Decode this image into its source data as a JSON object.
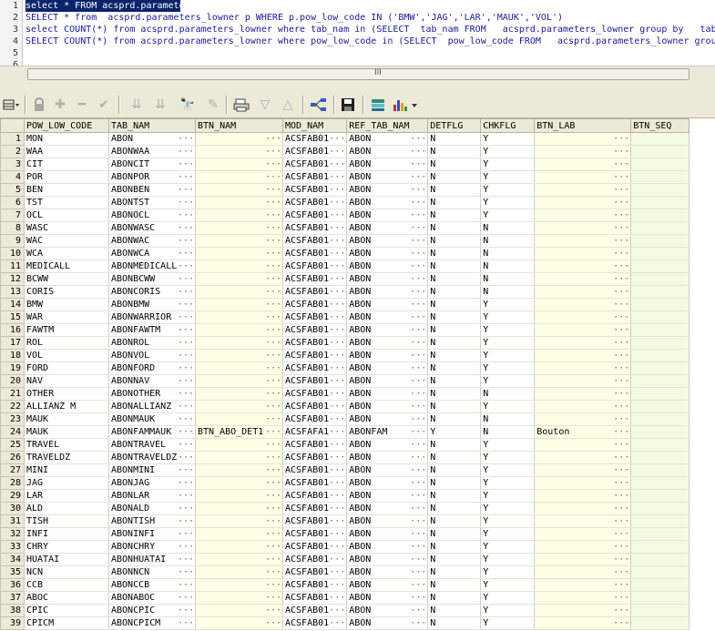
{
  "editor": {
    "line_numbers": [
      "1",
      "2",
      "3",
      "4",
      "5",
      "6"
    ],
    "lines": [
      "select * FROM acsprd.parameters_lowner",
      "SELECT * from  acsprd.parameters_lowner p WHERE p.pow_low_code IN ('BMW','JAG','LAR','MAUK','VOL')",
      "select COUNT(*) from acsprd.parameters_lowner where tab_nam in (SELECT  tab_nam FROM   acsprd.parameters_lowner group by   tab",
      "SELECT COUNT(*) from acsprd.parameters_lowner where pow_low_code in (SELECT  pow_low_code FROM   acsprd.parameters_lowner grou",
      "",
      ""
    ]
  },
  "scrollbar": {
    "grip": "III"
  },
  "toolbar": {
    "icons": [
      "lock-icon",
      "plus-icon",
      "minus-icon",
      "check-icon",
      "down-arrows-icon",
      "down-arrows-icon",
      "binoculars-icon",
      "eraser-icon",
      "print-icon",
      "triangle-down-icon",
      "triangle-up-icon",
      "graph-icon",
      "save-icon",
      "query-icon",
      "chart-icon"
    ]
  },
  "grid": {
    "columns": [
      "POW_LOW_CODE",
      "TAB_NAM",
      "BTN_NAM",
      "MOD_NAM",
      "REF_TAB_NAM",
      "DETFLG",
      "CHKFLG",
      "BTN_LAB",
      "BTN_SEQ"
    ],
    "rows": [
      [
        "1",
        "MON",
        "ABON",
        "",
        "ACSFAB01",
        "ABON",
        "N",
        "Y",
        "",
        ""
      ],
      [
        "2",
        "WAA",
        "ABONWAA",
        "",
        "ACSFAB01",
        "ABON",
        "N",
        "Y",
        "",
        ""
      ],
      [
        "3",
        "CIT",
        "ABONCIT",
        "",
        "ACSFAB01",
        "ABON",
        "N",
        "Y",
        "",
        ""
      ],
      [
        "4",
        "POR",
        "ABONPOR",
        "",
        "ACSFAB01",
        "ABON",
        "N",
        "Y",
        "",
        ""
      ],
      [
        "5",
        "BEN",
        "ABONBEN",
        "",
        "ACSFAB01",
        "ABON",
        "N",
        "Y",
        "",
        ""
      ],
      [
        "6",
        "TST",
        "ABONTST",
        "",
        "ACSFAB01",
        "ABON",
        "N",
        "Y",
        "",
        ""
      ],
      [
        "7",
        "OCL",
        "ABONOCL",
        "",
        "ACSFAB01",
        "ABON",
        "N",
        "Y",
        "",
        ""
      ],
      [
        "8",
        "WASC",
        "ABONWASC",
        "",
        "ACSFAB01",
        "ABON",
        "N",
        "N",
        "",
        ""
      ],
      [
        "9",
        "WAC",
        "ABONWAC",
        "",
        "ACSFAB01",
        "ABON",
        "N",
        "N",
        "",
        ""
      ],
      [
        "10",
        "WCA",
        "ABONWCA",
        "",
        "ACSFAB01",
        "ABON",
        "N",
        "N",
        "",
        ""
      ],
      [
        "11",
        "MEDICALL",
        "ABONMEDICALL",
        "",
        "ACSFAB01",
        "ABON",
        "N",
        "N",
        "",
        ""
      ],
      [
        "12",
        "BCWW",
        "ABONBCWW",
        "",
        "ACSFAB01",
        "ABON",
        "N",
        "N",
        "",
        ""
      ],
      [
        "13",
        "CORIS",
        "ABONCORIS",
        "",
        "ACSFAB01",
        "ABON",
        "N",
        "N",
        "",
        ""
      ],
      [
        "14",
        "BMW",
        "ABONBMW",
        "",
        "ACSFAB01",
        "ABON",
        "N",
        "Y",
        "",
        ""
      ],
      [
        "15",
        "WAR",
        "ABONWARRIOR",
        "",
        "ACSFAB01",
        "ABON",
        "N",
        "Y",
        "",
        ""
      ],
      [
        "16",
        "FAWTM",
        "ABONFAWTM",
        "",
        "ACSFAB01",
        "ABON",
        "N",
        "Y",
        "",
        ""
      ],
      [
        "17",
        "ROL",
        "ABONROL",
        "",
        "ACSFAB01",
        "ABON",
        "N",
        "Y",
        "",
        ""
      ],
      [
        "18",
        "VOL",
        "ABONVOL",
        "",
        "ACSFAB01",
        "ABON",
        "N",
        "Y",
        "",
        ""
      ],
      [
        "19",
        "FORD",
        "ABONFORD",
        "",
        "ACSFAB01",
        "ABON",
        "N",
        "Y",
        "",
        ""
      ],
      [
        "20",
        "NAV",
        "ABONNAV",
        "",
        "ACSFAB01",
        "ABON",
        "N",
        "Y",
        "",
        ""
      ],
      [
        "21",
        "OTHER",
        "ABONOTHER",
        "",
        "ACSFAB01",
        "ABON",
        "N",
        "N",
        "",
        ""
      ],
      [
        "22",
        "ALLIANZ M",
        "ABONALLIANZ",
        "",
        "ACSFAB01",
        "ABON",
        "N",
        "Y",
        "",
        ""
      ],
      [
        "23",
        "MAUK",
        "ABONMAUK",
        "",
        "ACSFAB01",
        "ABON",
        "N",
        "N",
        "",
        ""
      ],
      [
        "24",
        "MAUK",
        "ABONFAMMAUK",
        "BTN_ABO_DET1",
        "ACSFAFA1",
        "ABONFAM",
        "Y",
        "N",
        "Bouton",
        ""
      ],
      [
        "25",
        "TRAVEL",
        "ABONTRAVEL",
        "",
        "ACSFAB01",
        "ABON",
        "N",
        "Y",
        "",
        ""
      ],
      [
        "26",
        "TRAVELDZ",
        "ABONTRAVELDZ",
        "",
        "ACSFAB01",
        "ABON",
        "N",
        "Y",
        "",
        ""
      ],
      [
        "27",
        "MINI",
        "ABONMINI",
        "",
        "ACSFAB01",
        "ABON",
        "N",
        "Y",
        "",
        ""
      ],
      [
        "28",
        "JAG",
        "ABONJAG",
        "",
        "ACSFAB01",
        "ABON",
        "N",
        "Y",
        "",
        ""
      ],
      [
        "29",
        "LAR",
        "ABONLAR",
        "",
        "ACSFAB01",
        "ABON",
        "N",
        "Y",
        "",
        ""
      ],
      [
        "30",
        "ALD",
        "ABONALD",
        "",
        "ACSFAB01",
        "ABON",
        "N",
        "Y",
        "",
        ""
      ],
      [
        "31",
        "TISH",
        "ABONTISH",
        "",
        "ACSFAB01",
        "ABON",
        "N",
        "Y",
        "",
        ""
      ],
      [
        "32",
        "INFI",
        "ABONINFI",
        "",
        "ACSFAB01",
        "ABON",
        "N",
        "Y",
        "",
        ""
      ],
      [
        "33",
        "CHRY",
        "ABONCHRY",
        "",
        "ACSFAB01",
        "ABON",
        "N",
        "Y",
        "",
        ""
      ],
      [
        "34",
        "HUATAI",
        "ABONHUATAI",
        "",
        "ACSFAB01",
        "ABON",
        "N",
        "Y",
        "",
        ""
      ],
      [
        "35",
        "NCN",
        "ABONNCN",
        "",
        "ACSFAB01",
        "ABON",
        "N",
        "Y",
        "",
        ""
      ],
      [
        "36",
        "CCB",
        "ABONCCB",
        "",
        "ACSFAB01",
        "ABON",
        "N",
        "Y",
        "",
        ""
      ],
      [
        "37",
        "ABOC",
        "ABONABOC",
        "",
        "ACSFAB01",
        "ABON",
        "N",
        "Y",
        "",
        ""
      ],
      [
        "38",
        "CPIC",
        "ABONCPIC",
        "",
        "ACSFAB01",
        "ABON",
        "N",
        "Y",
        "",
        ""
      ],
      [
        "39",
        "CPICM",
        "ABONCPICM",
        "",
        "ACSFAB01",
        "ABON",
        "N",
        "Y",
        "",
        ""
      ]
    ]
  }
}
